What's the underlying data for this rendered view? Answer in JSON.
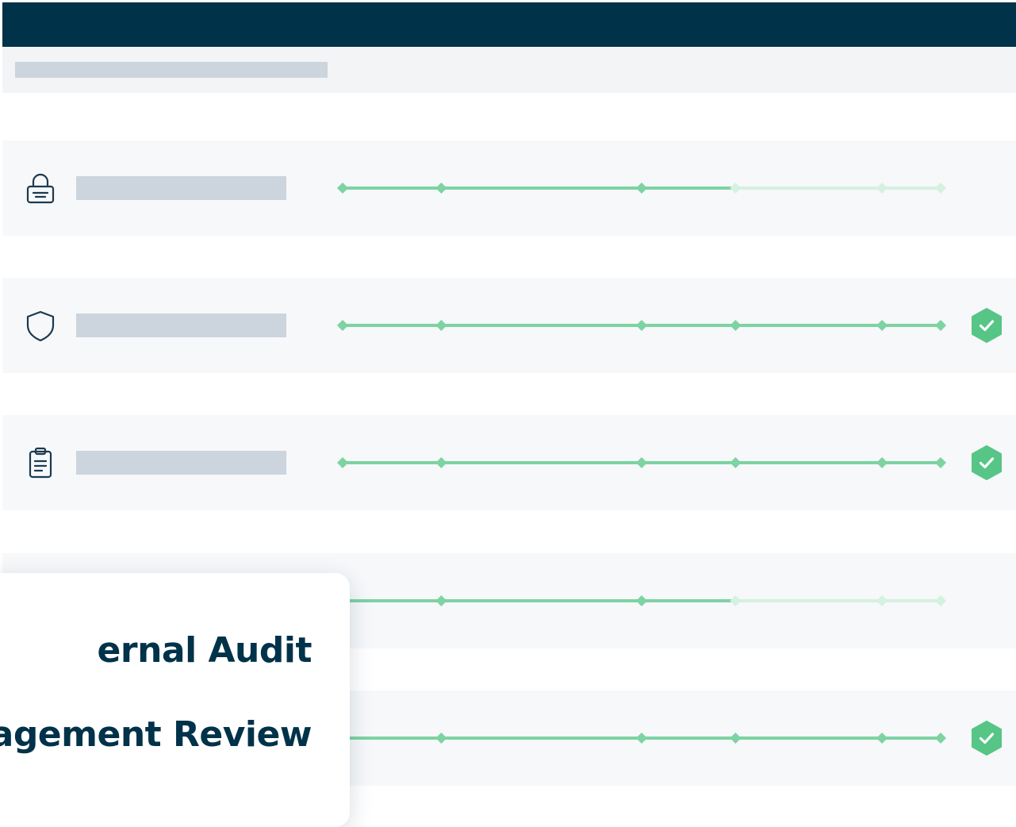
{
  "colors": {
    "header": "#00324a",
    "placeholder": "#ccd4dd",
    "row_bg": "#f6f8fa",
    "progress": "#7dd3a2",
    "progress_faded": "#d5f1e0",
    "badge": "#56c586"
  },
  "rows": [
    {
      "icon": "lock-icon",
      "progress": 0.65,
      "complete": false
    },
    {
      "icon": "shield-icon",
      "progress": 1.0,
      "complete": true
    },
    {
      "icon": "clipboard-icon",
      "progress": 1.0,
      "complete": true
    },
    {
      "icon": "",
      "progress": 0.65,
      "complete": false
    },
    {
      "icon": "",
      "progress": 1.0,
      "complete": true
    }
  ],
  "popup": {
    "items": [
      {
        "label": "ernal Audit"
      },
      {
        "label": "nagement Review"
      },
      {
        "label": ""
      }
    ]
  }
}
